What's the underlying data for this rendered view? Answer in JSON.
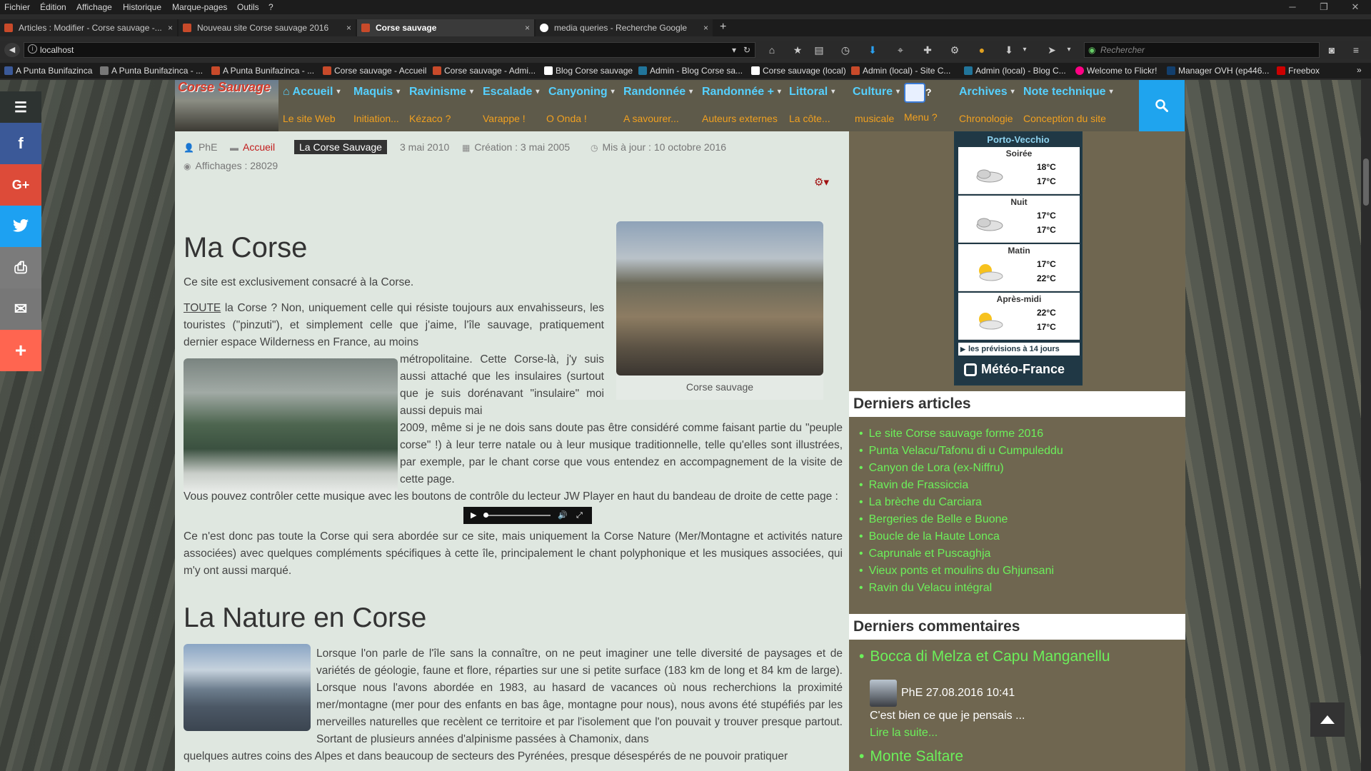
{
  "menubar": [
    "Fichier",
    "Édition",
    "Affichage",
    "Historique",
    "Marque-pages",
    "Outils",
    "?"
  ],
  "tabs": [
    {
      "label": "Articles : Modifier - Corse sauvage -...",
      "close": "×",
      "active": false,
      "color": "#c84a2a"
    },
    {
      "label": "Nouveau site Corse sauvage 2016",
      "close": "×",
      "active": false,
      "color": "#c84a2a"
    },
    {
      "label": "Corse sauvage",
      "close": "×",
      "active": true,
      "color": "#c84a2a"
    },
    {
      "label": "media queries - Recherche Google",
      "close": "×",
      "active": false,
      "color": "#ffffff"
    }
  ],
  "newtab": "+",
  "url": "localhost",
  "search_placeholder": "Rechercher",
  "bookmarks": [
    {
      "label": "A Punta Bunifazinca",
      "color": "#3b5998"
    },
    {
      "label": "A Punta Bunifazinca - ...",
      "color": "#777777"
    },
    {
      "label": "A Punta Bunifazinca - ...",
      "color": "#c84a2a"
    },
    {
      "label": "Corse sauvage - Accueil",
      "color": "#c84a2a"
    },
    {
      "label": "Corse sauvage - Admi...",
      "color": "#c84a2a"
    },
    {
      "label": "Blog Corse sauvage",
      "color": "#ffffff"
    },
    {
      "label": "Admin - Blog Corse sa...",
      "color": "#21759b"
    },
    {
      "label": "Corse sauvage (local)",
      "color": "#ffffff"
    },
    {
      "label": "Admin (local) - Site C...",
      "color": "#c84a2a"
    },
    {
      "label": "Admin (local) - Blog C...",
      "color": "#21759b"
    },
    {
      "label": "Welcome to Flickr!",
      "color": "#ff0084"
    },
    {
      "label": "Manager OVH (ep446...",
      "color": "#123f6d"
    },
    {
      "label": "Freebox",
      "color": "#cc0000"
    }
  ],
  "site": {
    "logo_text": "Corse Sauvage",
    "nav": [
      {
        "main": "Accueil",
        "sub": "Le site Web",
        "home": true
      },
      {
        "main": "Maquis",
        "sub": "Initiation..."
      },
      {
        "main": "Ravinisme",
        "sub": "Kézaco ?"
      },
      {
        "main": "Escalade",
        "sub": "Varappe !"
      },
      {
        "main": "Canyoning",
        "sub": "O Onda !"
      },
      {
        "main": "Randonnée",
        "sub": "A savourer..."
      },
      {
        "main": "Randonnée +",
        "sub": "Auteurs externes"
      },
      {
        "main": "Littoral",
        "sub": "La côte..."
      },
      {
        "main": "Culture",
        "sub": "musicale"
      },
      {
        "main": "?",
        "sub": "Menu ?"
      },
      {
        "main": "Archives",
        "sub": "Chronologie"
      },
      {
        "main": "Note technique",
        "sub": "Conception du site"
      }
    ]
  },
  "article": {
    "author": "PhE",
    "category_parent": "Accueil",
    "category": "La Corse Sauvage",
    "published": "3 mai 2010",
    "created": "Création : 3 mai 2005",
    "modified": "Mis à jour : 10 octobre 2016",
    "hits": "Affichages : 28029",
    "h1": "Ma Corse",
    "intro": "Ce site est exclusivement consacré à la Corse.",
    "p1_a": "TOUTE",
    "p1_top": "la Corse ? Non, uniquement celle qui résiste toujours aux envahisseurs, les touristes (\"pinzuti\"), et simplement celle que j'aime, l'île sauvage, pratiquement dernier espace Wilderness en France, au moins",
    "p1_side": "métropolitaine. Cette Corse-là, j'y suis aussi attaché que les insulaires (surtout que je suis dorénavant \"insulaire\" moi aussi depuis mai",
    "p1_rest": "2009, même si je ne dois sans doute pas être considéré comme faisant partie du \"peuple corse\" !) à leur terre natale ou à leur musique traditionnelle, telle qu'elles sont illustrées, par exemple, par le chant corse que vous entendez en accompagnement de la visite de cette page.",
    "p2": "Vous pouvez contrôler cette musique avec les boutons de contrôle du lecteur JW Player en haut du bandeau de droite de cette page :",
    "p3": "Ce n'est donc pas toute la Corse qui sera abordée sur ce site, mais uniquement la Corse Nature (Mer/Montagne et activités nature associées) avec quelques compléments spécifiques à cette île, principalement le chant polyphonique et les musiques associées, qui m'y ont aussi marqué.",
    "caption": "Corse sauvage",
    "h2": "La Nature en Corse",
    "p4_side": "Lorsque l'on parle de l'île sans la connaître, on ne peut imaginer une telle diversité de paysages et de variétés de géologie, faune et flore, réparties sur une si petite surface (183 km de long et 84 km de large). Lorsque nous l'avons abordée en 1983, au hasard de vacances où nous recherchions la proximité mer/montagne (mer pour des enfants en bas âge, montagne pour nous), nous avons été stupéfiés par les merveilles naturelles que recèlent ce territoire et par l'isolement que l'on pouvait y trouver presque partout. Sortant de plusieurs années d'alpinisme passées à Chamonix, dans",
    "p4_full": "quelques autres coins des Alpes et dans beaucoup de secteurs des Pyrénées, presque désespérés de ne pouvoir pratiquer"
  },
  "meteo": {
    "city": "Porto-Vecchio",
    "rows": [
      {
        "period": "Soirée",
        "t1": "18°C",
        "t2": "17°C",
        "icon": "cloudy-icon"
      },
      {
        "period": "Nuit",
        "t1": "17°C",
        "t2": "17°C",
        "icon": "cloudy-icon"
      },
      {
        "period": "Matin",
        "t1": "17°C",
        "t2": "22°C",
        "icon": "sun-cloud-icon"
      },
      {
        "period": "Après-midi",
        "t1": "22°C",
        "t2": "17°C",
        "icon": "sun-cloud-icon"
      }
    ],
    "link": "les prévisions à 14 jours",
    "brand": "Météo-France"
  },
  "latest_articles": {
    "title": "Derniers articles",
    "items": [
      "Le site Corse sauvage forme 2016",
      "Punta Velacu/Tafonu di u Cumpuleddu",
      "Canyon de Lora (ex-Niffru)",
      "Ravin de Frassiccia",
      "La brèche du Carciara",
      "Bergeries de Belle e Buone",
      "Boucle de la Haute Lonca",
      "Caprunale et Puscaghja",
      "Vieux ponts et moulins du Ghjunsani",
      "Ravin du Velacu intégral"
    ]
  },
  "latest_comments": {
    "title": "Derniers commentaires",
    "items": [
      {
        "title": "Bocca di Melza et Capu Manganellu",
        "author": "PhE 27.08.2016 10:41",
        "text": "C'est bien ce que je pensais ...",
        "more": "Lire la suite..."
      },
      {
        "title": "Monte Saltare"
      }
    ]
  },
  "colors": {
    "accent": "#1fa4ee",
    "nav_main": "#55d0ff",
    "nav_sub": "#f0a020",
    "sidebar_link": "#6cf05a"
  }
}
